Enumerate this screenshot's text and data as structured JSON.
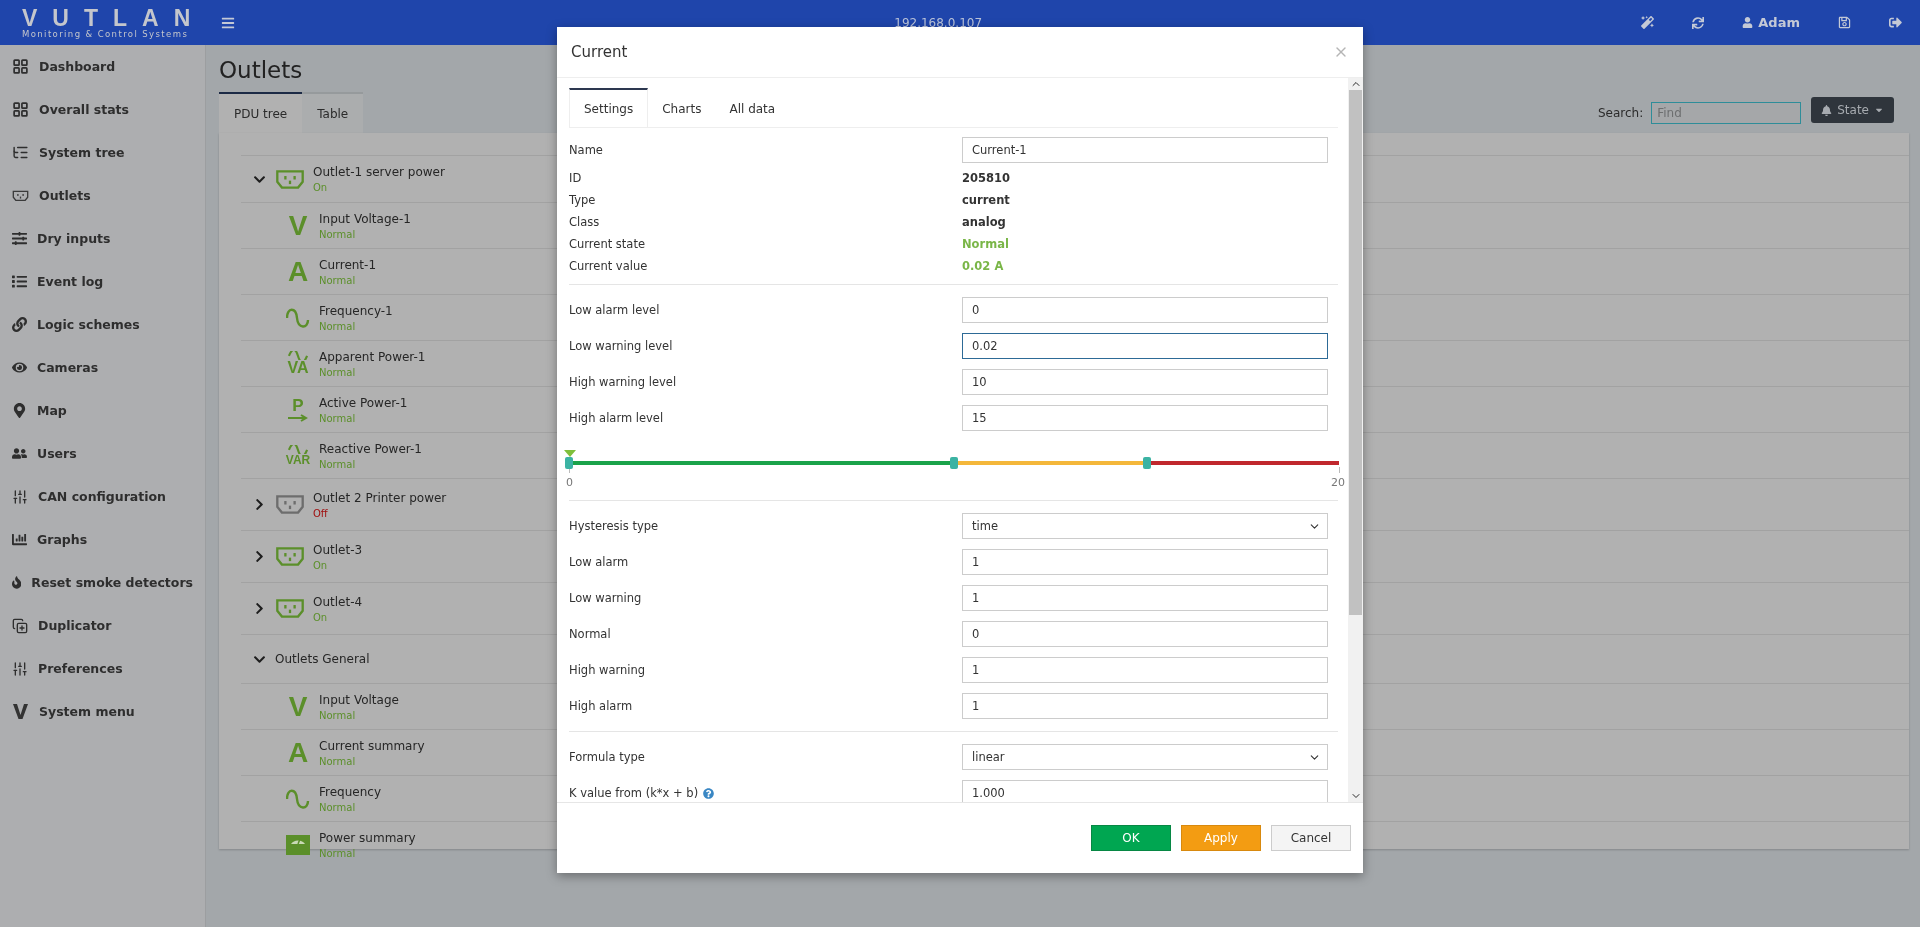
{
  "header": {
    "logo": "VUTLAN",
    "tagline": "Monitoring & Control Systems",
    "address": "192.168.0.107",
    "user": "Adam"
  },
  "sidebar": {
    "items": [
      {
        "label": "Dashboard"
      },
      {
        "label": "Overall stats"
      },
      {
        "label": "System tree"
      },
      {
        "label": "Outlets"
      },
      {
        "label": "Dry inputs"
      },
      {
        "label": "Event log"
      },
      {
        "label": "Logic schemes"
      },
      {
        "label": "Cameras"
      },
      {
        "label": "Map"
      },
      {
        "label": "Users"
      },
      {
        "label": "CAN configuration"
      },
      {
        "label": "Graphs"
      },
      {
        "label": "Reset smoke detectors"
      },
      {
        "label": "Duplicator"
      },
      {
        "label": "Preferences"
      },
      {
        "label": "System menu"
      }
    ]
  },
  "page": {
    "title": "Outlets",
    "tabs": [
      {
        "label": "PDU tree",
        "selected": true
      },
      {
        "label": "Table",
        "selected": false
      }
    ],
    "search": {
      "label": "Search:",
      "placeholder": "Find"
    },
    "state_button": "State"
  },
  "tree": [
    {
      "kind": "outlet",
      "name": "Outlet-1 server power",
      "status": "On",
      "on": true,
      "expanded": true,
      "children": [
        {
          "kind": "voltage",
          "symbol": "V",
          "name": "Input Voltage-1",
          "status": "Normal"
        },
        {
          "kind": "current",
          "symbol": "A",
          "name": "Current-1",
          "status": "Normal"
        },
        {
          "kind": "frequency",
          "name": "Frequency-1",
          "status": "Normal"
        },
        {
          "kind": "apparent",
          "symbol": "VA",
          "name": "Apparent Power-1",
          "status": "Normal"
        },
        {
          "kind": "active",
          "symbol": "P",
          "name": "Active Power-1",
          "status": "Normal"
        },
        {
          "kind": "reactive",
          "symbol": "VAR",
          "name": "Reactive Power-1",
          "status": "Normal"
        }
      ]
    },
    {
      "kind": "outlet",
      "name": "Outlet 2 Printer power",
      "status": "Off",
      "on": false,
      "expanded": false
    },
    {
      "kind": "outlet",
      "name": "Outlet-3",
      "status": "On",
      "on": true,
      "expanded": false
    },
    {
      "kind": "outlet",
      "name": "Outlet-4",
      "status": "On",
      "on": true,
      "expanded": false
    },
    {
      "kind": "group",
      "name": "Outlets General",
      "expanded": true,
      "children": [
        {
          "kind": "voltage",
          "symbol": "V",
          "name": "Input Voltage",
          "status": "Normal"
        },
        {
          "kind": "current",
          "symbol": "A",
          "name": "Current summary",
          "status": "Normal"
        },
        {
          "kind": "frequency",
          "name": "Frequency",
          "status": "Normal"
        },
        {
          "kind": "power",
          "name": "Power summary",
          "status": "Normal"
        }
      ]
    }
  ],
  "modal": {
    "title": "Current",
    "tabs": [
      {
        "label": "Settings",
        "selected": true
      },
      {
        "label": "Charts",
        "selected": false
      },
      {
        "label": "All data",
        "selected": false
      }
    ],
    "info": [
      {
        "label": "Name",
        "kind": "input",
        "value": "Current-1"
      },
      {
        "label": "ID",
        "kind": "text",
        "value": "205810"
      },
      {
        "label": "Type",
        "kind": "text",
        "value": "current"
      },
      {
        "label": "Class",
        "kind": "text",
        "value": "analog"
      },
      {
        "label": "Current state",
        "kind": "status",
        "value": "Normal"
      },
      {
        "label": "Current value",
        "kind": "status",
        "value": "0.02 A"
      }
    ],
    "thresholds": [
      {
        "label": "Low alarm level",
        "value": "0",
        "focused": false
      },
      {
        "label": "Low warning level",
        "value": "0.02",
        "focused": true
      },
      {
        "label": "High warning level",
        "value": "10",
        "focused": false
      },
      {
        "label": "High alarm level",
        "value": "15",
        "focused": false
      }
    ],
    "scale": {
      "min": "0",
      "max": "20",
      "pointer": {
        "level": 0.001
      },
      "handles": [
        {
          "level": 0
        },
        {
          "level": 0.5
        },
        {
          "level": 0.75
        }
      ]
    },
    "hysteresis": [
      {
        "label": "Hysteresis type",
        "kind": "select",
        "value": "time"
      },
      {
        "label": "Low alarm",
        "kind": "input",
        "value": "1"
      },
      {
        "label": "Low warning",
        "kind": "input",
        "value": "1"
      },
      {
        "label": "Normal",
        "kind": "input",
        "value": "0"
      },
      {
        "label": "High warning",
        "kind": "input",
        "value": "1"
      },
      {
        "label": "High alarm",
        "kind": "input",
        "value": "1"
      }
    ],
    "formula": [
      {
        "label": "Formula type",
        "kind": "select",
        "value": "linear"
      },
      {
        "label": "K value from (k*x + b)",
        "kind": "input",
        "value": "1.000",
        "help": true
      }
    ],
    "buttons": [
      {
        "label": "OK",
        "kind": "primary"
      },
      {
        "label": "Apply",
        "kind": "warning"
      },
      {
        "label": "Cancel",
        "kind": "default"
      }
    ]
  }
}
